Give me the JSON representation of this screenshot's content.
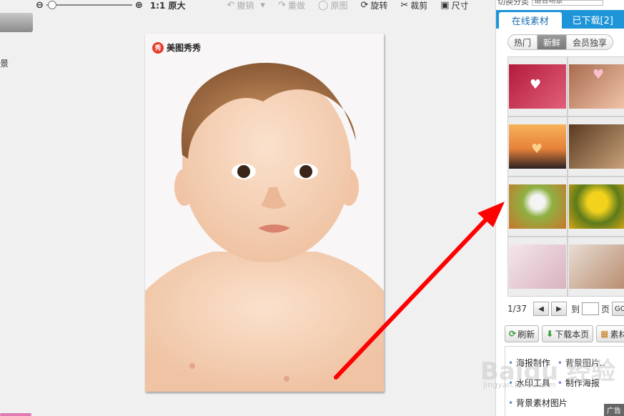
{
  "left": {
    "partial_label": "景"
  },
  "toolbar": {
    "zoom_out_icon": "zoom-out-icon",
    "zoom_in_icon": "zoom-in-icon",
    "actual_size_label": "1:1 原大",
    "undo_label": "撤销",
    "redo_label": "重做",
    "original_label": "原图",
    "rotate_label": "旋转",
    "crop_label": "裁剪",
    "size_label": "尺寸"
  },
  "photo": {
    "logo_text": "美图秀秀",
    "logo_mark": "秀"
  },
  "panel": {
    "top_label": "切换分类",
    "top_input": "适合场景",
    "tabs": [
      "在线素材",
      "已下载[2]"
    ],
    "segments": [
      "热门",
      "新鲜",
      "会员独享"
    ],
    "pager": {
      "page_info": "1/37",
      "goto_label": "到",
      "page_label": "页",
      "go_label": "GO"
    },
    "actions": [
      "刷新",
      "下载本页",
      "素材"
    ],
    "links": [
      [
        "海报制作",
        "背景图片.."
      ],
      [
        "水印工具",
        "制作海报"
      ],
      [
        "背景素材图片"
      ]
    ],
    "ad_label": "广告"
  },
  "watermark": {
    "brand": "Baidu 经验",
    "url": "jingyan.baidu.com"
  },
  "colors": {
    "accent_blue": "#1e95d8",
    "arrow_red": "#ff0000"
  }
}
